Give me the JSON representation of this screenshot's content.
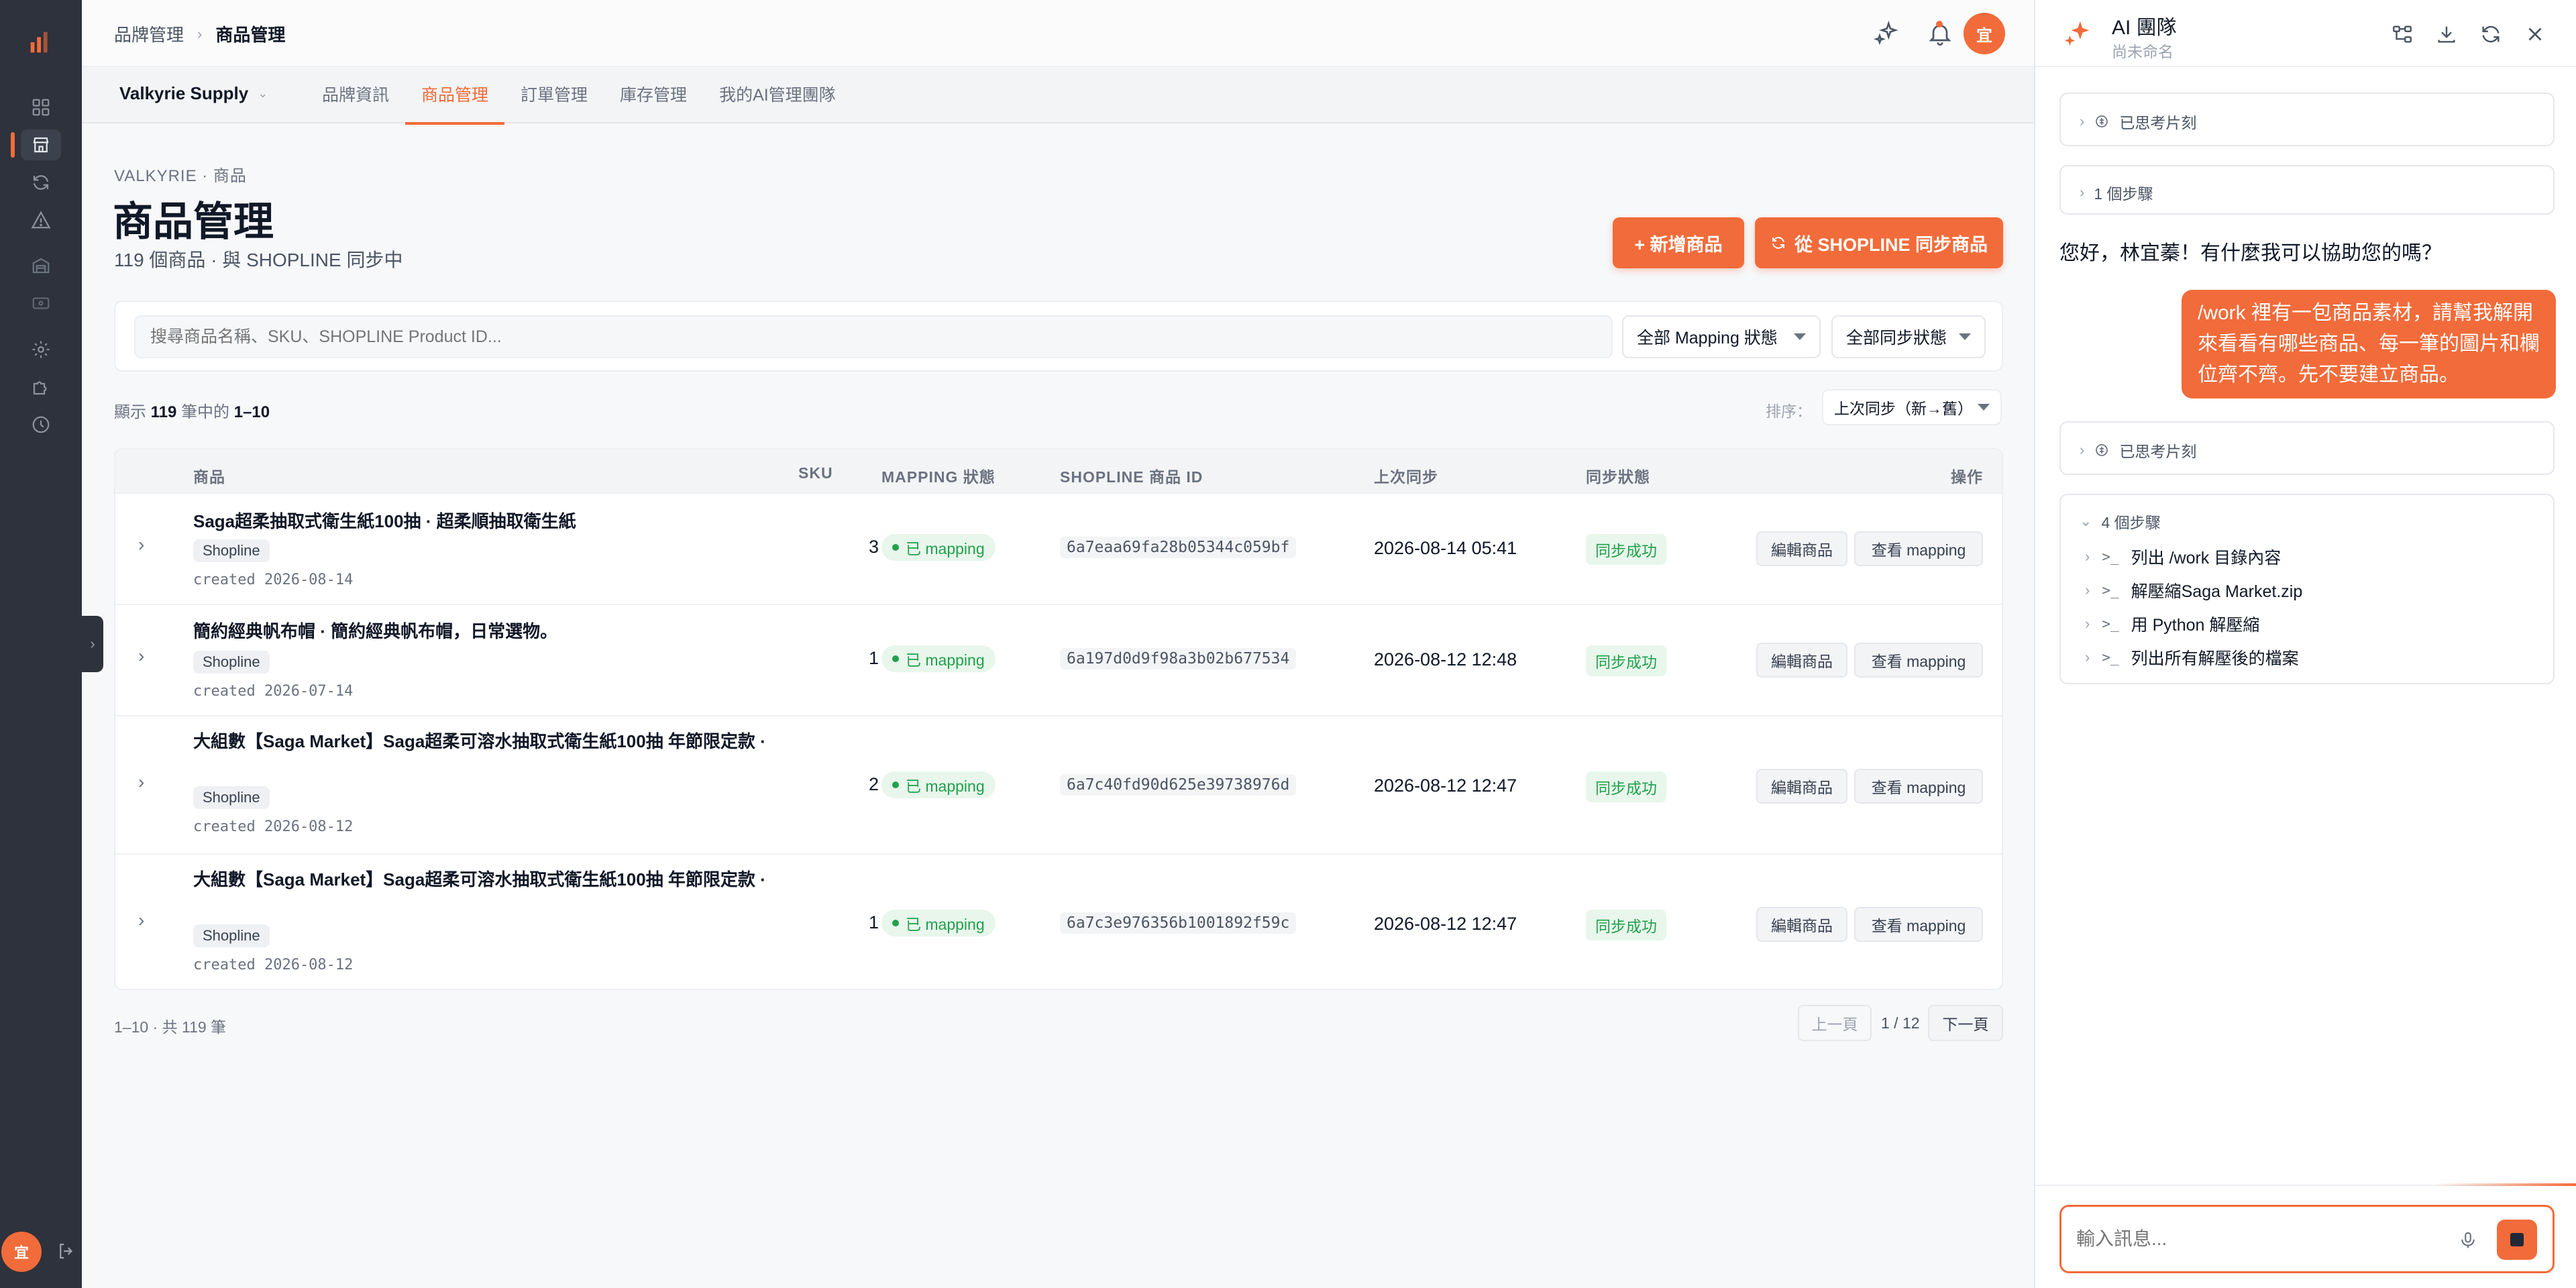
{
  "rail": {
    "icons": [
      "analytics-logo-icon",
      "dashboard-icon",
      "store-icon",
      "sync-icon",
      "warning-icon",
      "warehouse-icon",
      "card-icon",
      "settings-icon",
      "puzzle-icon",
      "history-icon"
    ],
    "user_initial": "宜",
    "toggle_glyph": "›"
  },
  "header": {
    "breadcrumb": [
      "品牌管理",
      "商品管理"
    ],
    "breadcrumb_sep": "›",
    "avatar_initial": "宜"
  },
  "subnav": {
    "brand": "Valkyrie Supply",
    "brand_chevron": "⌄",
    "tabs": [
      "品牌資訊",
      "商品管理",
      "訂單管理",
      "庫存管理",
      "我的AI管理團隊"
    ],
    "active_tab": 1
  },
  "page": {
    "eyebrow": "VALKYRIE · 商品",
    "title": "商品管理",
    "subtitle": "119 個商品 · 與 SHOPLINE 同步中",
    "add_button": "+ 新增商品",
    "sync_button": "從 SHOPLINE 同步商品"
  },
  "filters": {
    "search_placeholder": "搜尋商品名稱、SKU、SHOPLINE Product ID...",
    "mapping_select": "全部 Mapping 狀態",
    "sync_select": "全部同步狀態"
  },
  "list_meta": {
    "prefix": "顯示",
    "total": "119",
    "middle": "筆中的",
    "range": "1–10",
    "sort_label": "排序：",
    "sort_value": "上次同步（新→舊）"
  },
  "table": {
    "headers": [
      "商品",
      "SKU",
      "MAPPING 狀態",
      "SHOPLINE 商品 ID",
      "上次同步",
      "同步狀態",
      "操作"
    ],
    "expand_glyph": "›",
    "edit_label": "編輯商品",
    "view_label": "查看 mapping",
    "rows": [
      {
        "name": "Saga超柔抽取式衛生紙100抽 · 超柔順抽取衛生紙",
        "channel": "Shopline",
        "created": "created 2026-08-14",
        "sku": "3",
        "mapping": "已 mapping",
        "product_id": "6a7eaa69fa28b05344c059bf",
        "last_sync": "2026-08-14 05:41",
        "sync_status": "同步成功"
      },
      {
        "name": "簡約經典帆布帽 · 簡約經典帆布帽，日常選物。",
        "channel": "Shopline",
        "created": "created 2026-07-14",
        "sku": "1",
        "mapping": "已 mapping",
        "product_id": "6a197d0d9f98a3b02b677534",
        "last_sync": "2026-08-12 12:48",
        "sync_status": "同步成功"
      },
      {
        "name": "大組數【Saga Market】Saga超柔可溶水抽取式衛生紙100抽 年節限定款 ·",
        "channel": "Shopline",
        "created": "created 2026-08-12",
        "sku": "2",
        "mapping": "已 mapping",
        "product_id": "6a7c40fd90d625e39738976d",
        "last_sync": "2026-08-12 12:47",
        "sync_status": "同步成功"
      },
      {
        "name": "大組數【Saga Market】Saga超柔可溶水抽取式衛生紙100抽 年節限定款 ·",
        "channel": "Shopline",
        "created": "created 2026-08-12",
        "sku": "1",
        "mapping": "已 mapping",
        "product_id": "6a7c3e976356b1001892f59c",
        "last_sync": "2026-08-12 12:47",
        "sync_status": "同步成功"
      }
    ]
  },
  "pagination": {
    "info": "1–10 · 共 119 筆",
    "prev": "上一頁",
    "page": "1 / 12",
    "next": "下一頁"
  },
  "ai": {
    "title": "AI 團隊",
    "subtitle": "尚未命名",
    "chevron": "›",
    "chevron_open": "⌄",
    "terminal_glyph": ">_",
    "thought_1": "已思考片刻",
    "steps_1": "1 個步驟",
    "greeting": "您好，林宜蓁！有什麼我可以協助您的嗎？",
    "user_message": "/work 裡有一包商品素材，請幫我解開來看看有哪些商品、每一筆的圖片和欄位齊不齊。先不要建立商品。",
    "thought_2": "已思考片刻",
    "steps_2": "4 個步驟",
    "step_items": [
      "列出 /work 目錄內容",
      "解壓縮Saga Market.zip",
      "用 Python 解壓縮",
      "列出所有解壓後的檔案"
    ],
    "input_placeholder": "輸入訊息..."
  },
  "colors": {
    "accent": "#f26b3a",
    "rail": "#2d323c",
    "success": "#22a04b",
    "success_bg": "#e8f6ec"
  }
}
